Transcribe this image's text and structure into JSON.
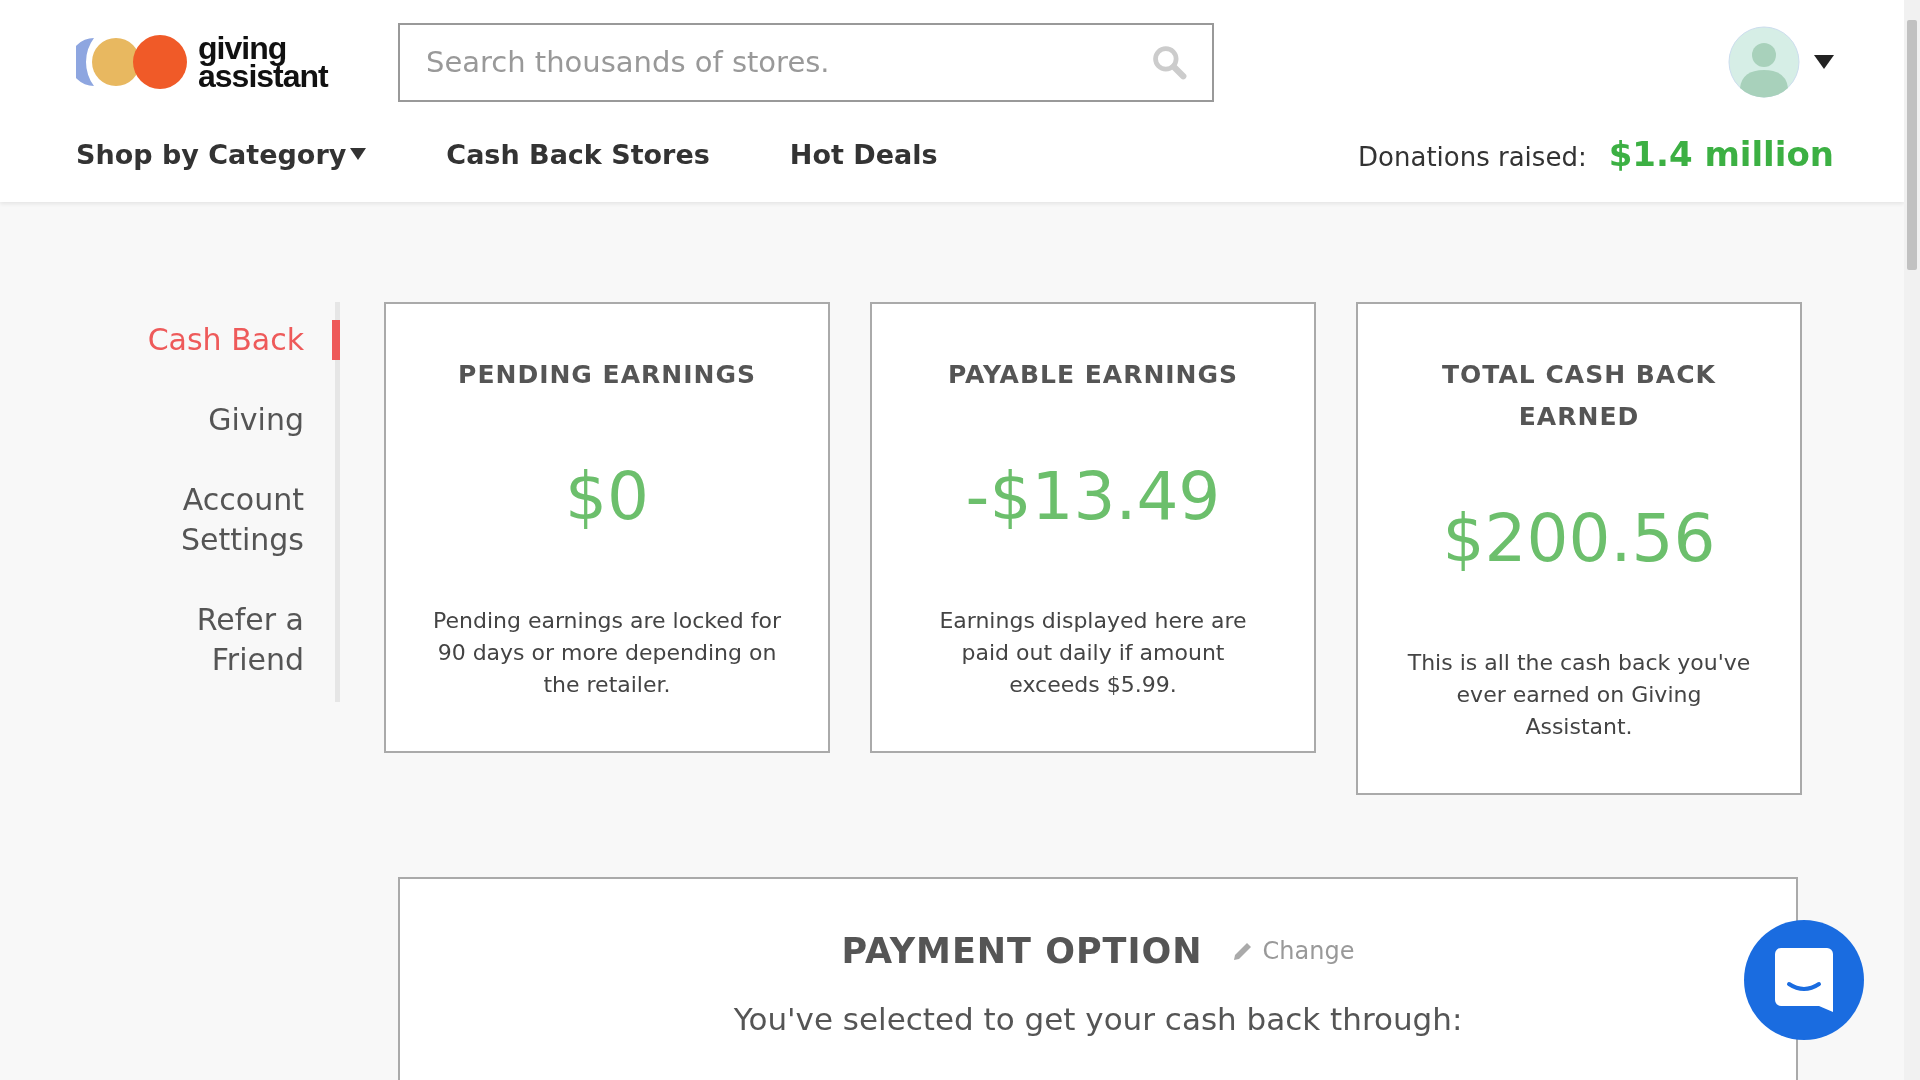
{
  "header": {
    "logo": {
      "line_1": "giving",
      "line_2": "assistant"
    },
    "search": {
      "placeholder": "Search thousands of stores."
    },
    "nav": [
      {
        "label": "Shop by Category",
        "dropdown": true
      },
      {
        "label": "Cash Back Stores",
        "dropdown": false
      },
      {
        "label": "Hot Deals",
        "dropdown": false
      }
    ],
    "donations": {
      "label": "Donations raised:",
      "value": "$1.4 million"
    }
  },
  "sidebar": {
    "items": [
      {
        "label": "Cash Back",
        "selected": true
      },
      {
        "label": "Giving",
        "selected": false
      },
      {
        "label": "Account Settings",
        "selected": false
      },
      {
        "label": "Refer a Friend",
        "selected": false
      }
    ]
  },
  "cards": [
    {
      "title": "PENDING EARNINGS",
      "amount": "$0",
      "description": "Pending earnings are locked for 90 days or more depending on the retailer."
    },
    {
      "title": "PAYABLE EARNINGS",
      "amount": "-$13.49",
      "description": "Earnings displayed here are paid out daily if amount exceeds $5.99."
    },
    {
      "title": "TOTAL CASH BACK EARNED",
      "amount": "$200.56",
      "description": "This is all the cash back you've ever earned on Giving Assistant."
    }
  ],
  "payment": {
    "title": "PAYMENT OPTION",
    "change": "Change",
    "text": "You've selected to get your cash back through:"
  }
}
